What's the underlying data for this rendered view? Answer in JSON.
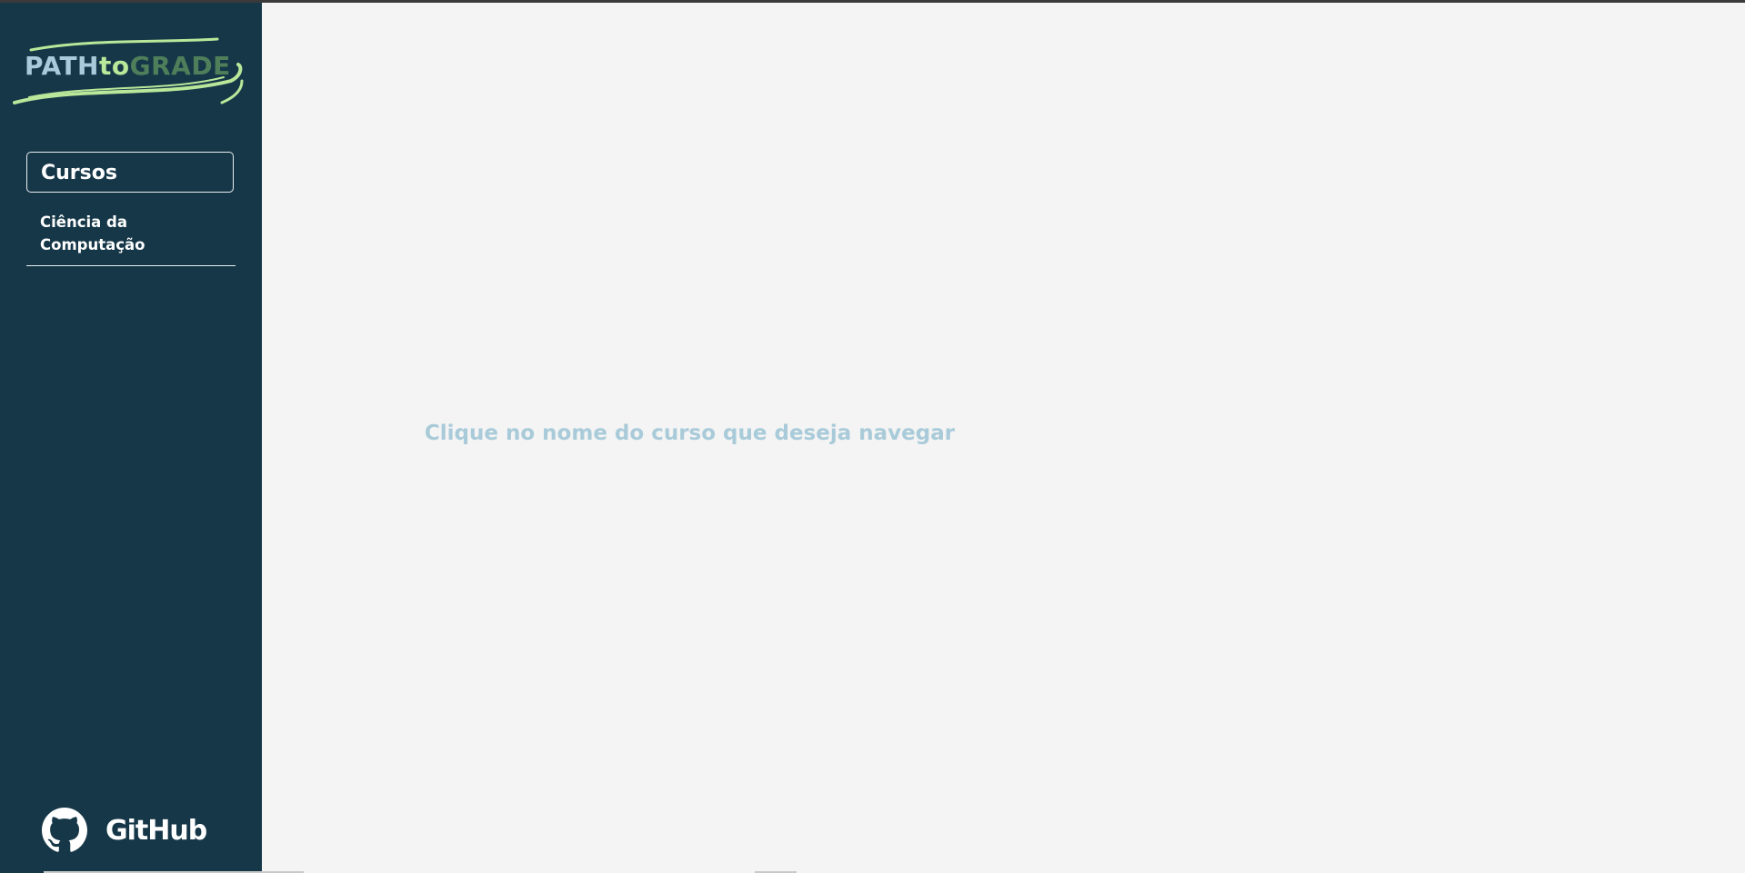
{
  "sidebar": {
    "logo": {
      "part_path": "PATH",
      "part_to": "to",
      "part_grade": "GRADE",
      "colors": {
        "path": "#a9cbd9",
        "to": "#b9e89a",
        "grade": "#4f7f5a",
        "swoosh": "#b9e89a"
      }
    },
    "courses_header": "Cursos",
    "course_items": [
      {
        "label": "Ciência da Computação"
      }
    ],
    "github": {
      "label": "GitHub",
      "icon": "github-icon"
    },
    "background": "#163748"
  },
  "main": {
    "hint": "Clique no nome do curso que deseja navegar",
    "background": "#f4f4f4",
    "hint_color": "#a9cbd9"
  }
}
